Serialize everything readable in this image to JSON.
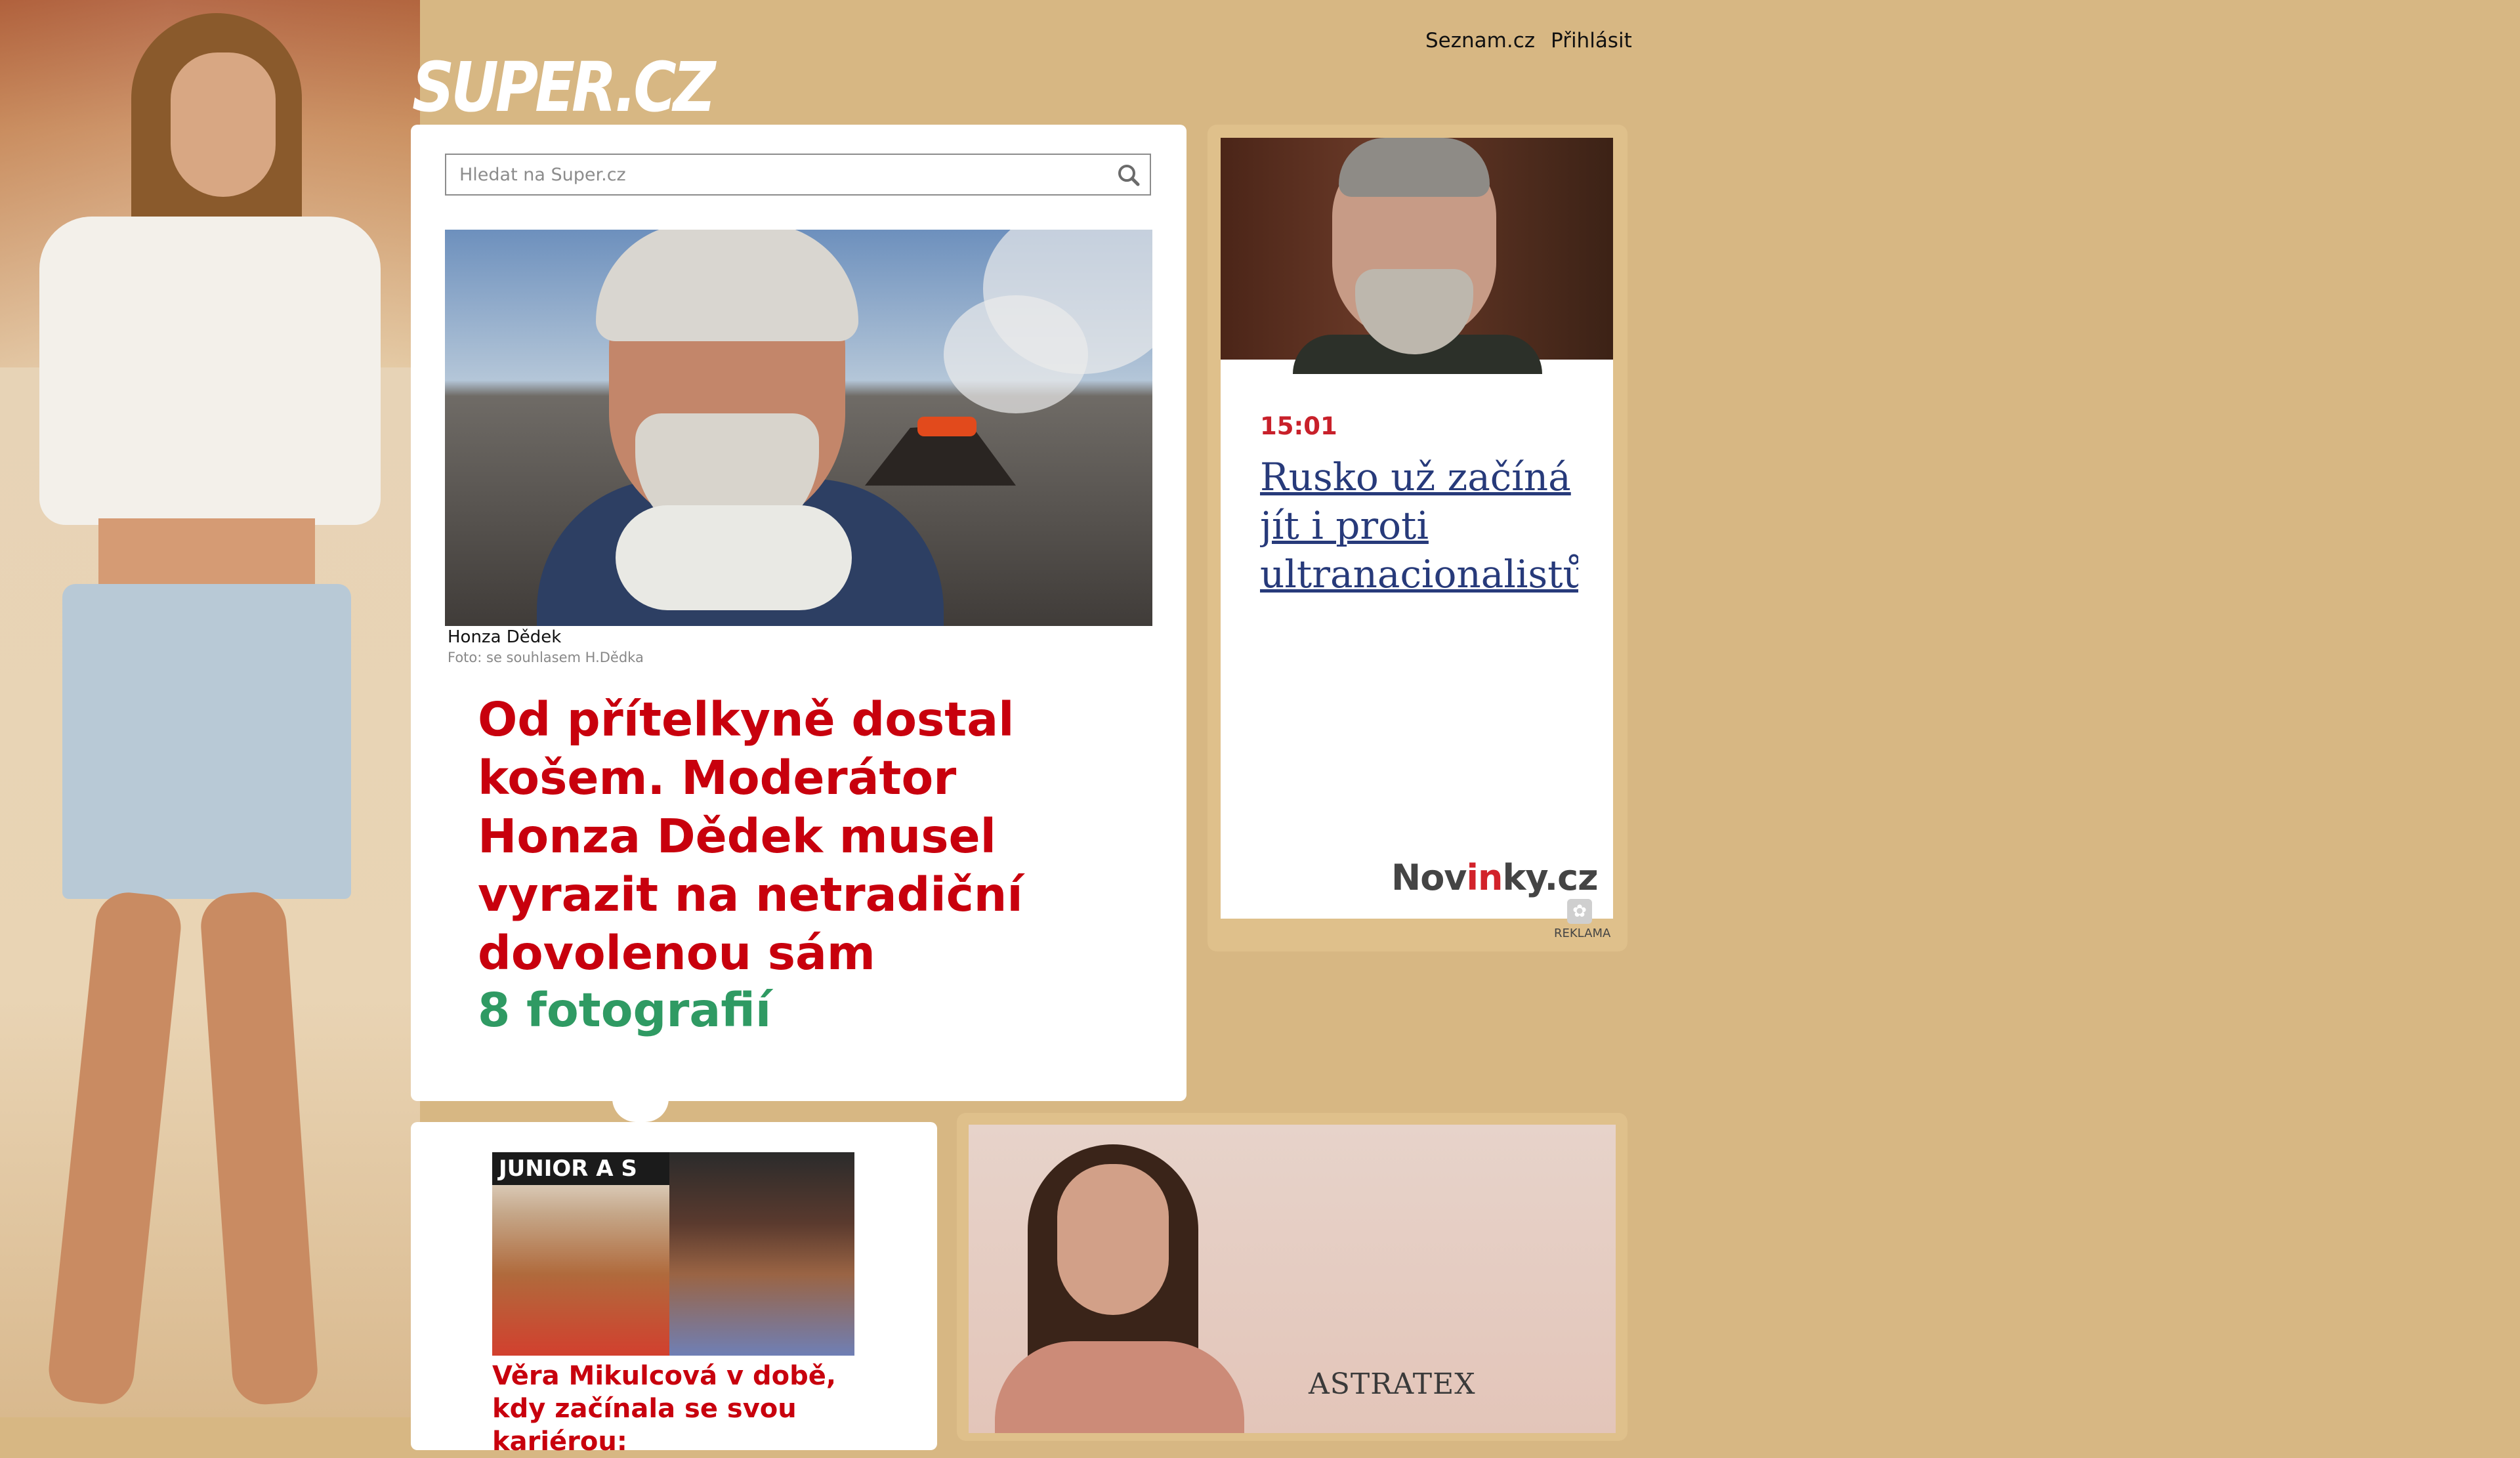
{
  "header": {
    "logo_text": "SUPER.CZ",
    "nav": [
      "Seznam.cz",
      "Přihlásit"
    ]
  },
  "search": {
    "placeholder": "Hledat na Super.cz"
  },
  "main_article": {
    "caption": "Honza Dědek",
    "credit": "Foto: se souhlasem H.Dědka",
    "headline": "Od přítelkyně dostal košem. Moderátor Honza Dědek musel vyrazit na netradiční dovolenou sám",
    "photo_count": "8 fotografií"
  },
  "ad_novinky": {
    "time": "15:01",
    "title": "Rusko už začíná jít i proti ultranacionalistům",
    "brand_a": "Nov",
    "brand_b": "in",
    "brand_c": "ky.cz",
    "label": "REKLAMA"
  },
  "second_article": {
    "image_banner": "JUNIOR A S",
    "headline": "Věra Mikulcová v době, kdy začínala se svou kariérou:"
  },
  "ad_astratex": {
    "brand": "ASTRATEX"
  },
  "colors": {
    "background": "#d7b783",
    "headline_red": "#c8000d",
    "photo_count_green": "#2f9a63",
    "novinky_link": "#273a7a",
    "time_red": "#c8202a"
  }
}
